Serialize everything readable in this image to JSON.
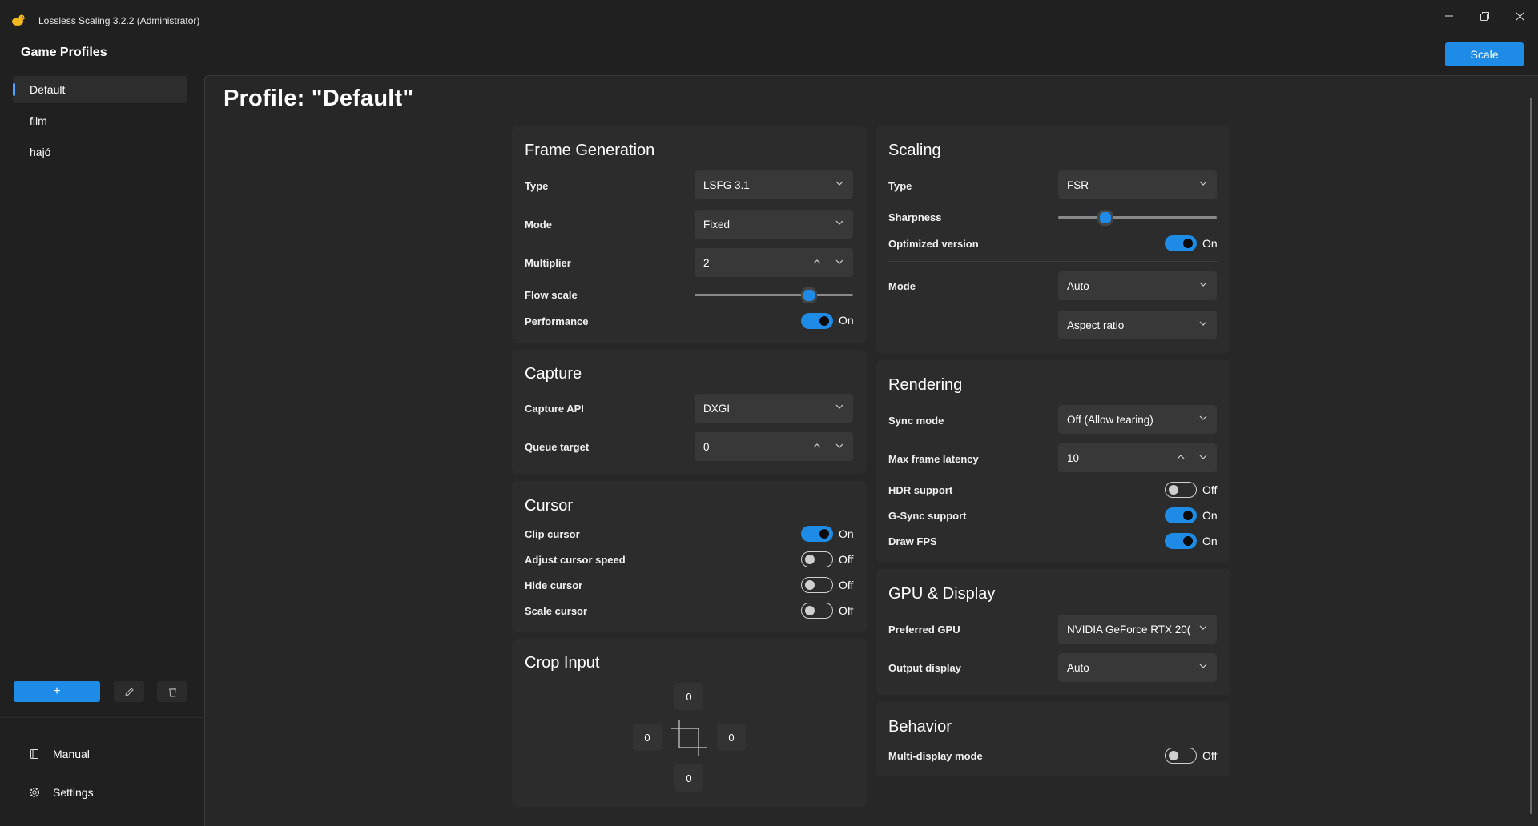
{
  "window": {
    "title": "Lossless Scaling 3.2.2 (Administrator)",
    "controls": [
      "minimize-icon",
      "restore-icon",
      "close-icon"
    ]
  },
  "sidebar": {
    "heading": "Game Profiles",
    "profiles": [
      {
        "label": "Default",
        "selected": true
      },
      {
        "label": "film",
        "selected": false
      },
      {
        "label": "hajó",
        "selected": false
      }
    ],
    "add_label": "+",
    "nav": [
      {
        "label": "Manual",
        "icon": "book-icon"
      },
      {
        "label": "Settings",
        "icon": "gear-icon"
      }
    ]
  },
  "header": {
    "scale_button": "Scale"
  },
  "main": {
    "page_title": "Profile: \"Default\"",
    "frame_generation": {
      "title": "Frame Generation",
      "type_label": "Type",
      "type_value": "LSFG 3.1",
      "mode_label": "Mode",
      "mode_value": "Fixed",
      "multiplier_label": "Multiplier",
      "multiplier_value": "2",
      "flow_scale_label": "Flow scale",
      "flow_scale_level": 0.72,
      "performance_label": "Performance",
      "performance_state": "On"
    },
    "capture": {
      "title": "Capture",
      "api_label": "Capture API",
      "api_value": "DXGI",
      "queue_label": "Queue target",
      "queue_value": "0"
    },
    "cursor": {
      "title": "Cursor",
      "rows": [
        {
          "label": "Clip cursor",
          "state": "On"
        },
        {
          "label": "Adjust cursor speed",
          "state": "Off"
        },
        {
          "label": "Hide cursor",
          "state": "Off"
        },
        {
          "label": "Scale cursor",
          "state": "Off"
        }
      ]
    },
    "crop_input": {
      "title": "Crop Input",
      "top": "0",
      "left": "0",
      "right": "0",
      "bottom": "0"
    },
    "scaling": {
      "title": "Scaling",
      "type_label": "Type",
      "type_value": "FSR",
      "sharpness_label": "Sharpness",
      "sharpness_level": 0.3,
      "optimized_label": "Optimized version",
      "optimized_state": "On",
      "mode_label": "Mode",
      "mode_value": "Auto",
      "aspect_value": "Aspect ratio"
    },
    "rendering": {
      "title": "Rendering",
      "sync_label": "Sync mode",
      "sync_value": "Off (Allow tearing)",
      "latency_label": "Max frame latency",
      "latency_value": "10",
      "rows": [
        {
          "label": "HDR support",
          "state": "Off"
        },
        {
          "label": "G-Sync support",
          "state": "On"
        },
        {
          "label": "Draw FPS",
          "state": "On"
        }
      ]
    },
    "gpu_display": {
      "title": "GPU & Display",
      "gpu_label": "Preferred GPU",
      "gpu_value": "NVIDIA GeForce RTX 20(",
      "output_label": "Output display",
      "output_value": "Auto"
    },
    "behavior": {
      "title": "Behavior",
      "multi_label": "Multi-display mode",
      "multi_state": "Off"
    }
  },
  "colors": {
    "accent": "#1e8ce6",
    "background": "#202020",
    "panel": "#272727",
    "card": "#2c2c2c",
    "control": "#383838"
  }
}
